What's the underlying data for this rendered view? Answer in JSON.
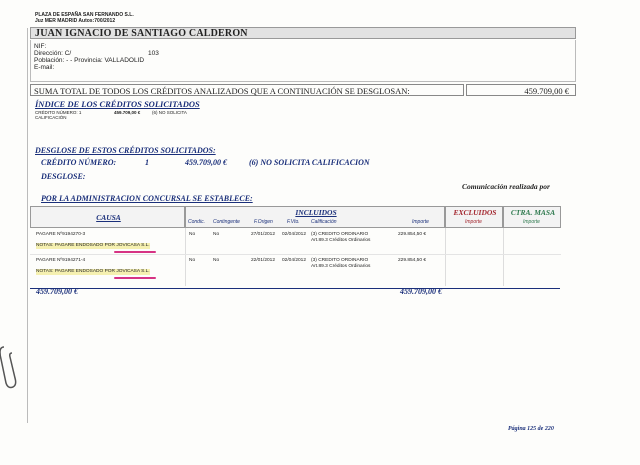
{
  "header": {
    "firm": "PLAZA DE ESPAÑA SAN FERNANDO S.L.",
    "auto": "Juz MER MADRID Autos:700/2012"
  },
  "person": {
    "name": "JUAN IGNACIO DE SANTIAGO CALDERON",
    "nif_label": "NIF:",
    "direccion": "Dirección: C/",
    "direccion_num": "103",
    "poblacion": "Población: -  -  Provincia: VALLADOLID",
    "email_label": "E-mail:"
  },
  "summary": {
    "label": "SUMA TOTAL DE TODOS LOS CRÉDITOS ANALIZADOS QUE A CONTINUACIÓN SE DESGLOSAN:",
    "value": "459.709,00 €"
  },
  "indice": {
    "title": "ÍNDICE DE LOS CRÉDITOS SOLICITADOS",
    "credito_line": "CRÉDITO NÚMERO: 1",
    "credito_amount": "459.709,00 €",
    "credito_status": "(6) NO SOLICITA",
    "calificacion": "CALIFICACIÓN"
  },
  "desglose": {
    "title": "DESGLOSE DE ESTOS CRÉDITOS SOLICITADOS:",
    "credito_label": "CRÉDITO NÚMERO:",
    "credito_num": "1",
    "credito_amount": "459.709,00 €",
    "credito_calif": "(6) NO SOLICITA CALIFICACION",
    "desglose_label": "DESGLOSE:",
    "comunicacion": "Comunicación realizada por",
    "administracion": "POR LA ADMINISTRACION CONCURSAL SE ESTABLECE:"
  },
  "table": {
    "headers": {
      "causa": "CAUSA",
      "incluidos": "INCLUIDOS",
      "excluidos": "EXCLUIDOS",
      "masa": "CTRA. MASA"
    },
    "subheaders": [
      "Condic.",
      "Contingente",
      "F.Origen",
      "F.Vto.",
      "Calificación",
      "Importe",
      "Importe",
      "Importe"
    ],
    "rows": [
      {
        "causa": "PAGARE Nº9194270-3",
        "condic": "No",
        "contingente": "No",
        "f_origen": "27/01/2012",
        "f_vto": "02/04/2012",
        "calif": "(3) CREDITO ORDINARIO",
        "calif2": "Art.89.3 Créditos Ordinarios",
        "importe": "229.854,50 €",
        "notas": "NOTAS: PAGARE ENDOSADO POR JOVICASA S.L."
      },
      {
        "causa": "PAGARE Nº9194271-4",
        "condic": "No",
        "contingente": "No",
        "f_origen": "22/01/2012",
        "f_vto": "02/04/2012",
        "calif": "(3) CREDITO ORDINARIO",
        "calif2": "Art.89.3 Créditos Ordinarios",
        "importe": "229.854,50 €",
        "notas": "NOTAS: PAGARE ENDOSADO POR JOVICASA S.L."
      }
    ],
    "total_left": "459.709,00 €",
    "total_right": "459.709,00 €"
  },
  "footer": {
    "page": "Página 125 de 220"
  },
  "colors": {
    "blue": "#1a2f7a",
    "red": "#a3262e",
    "green": "#2f7a4f",
    "highlight": "#f5f0b0",
    "pen": "#d63384"
  }
}
